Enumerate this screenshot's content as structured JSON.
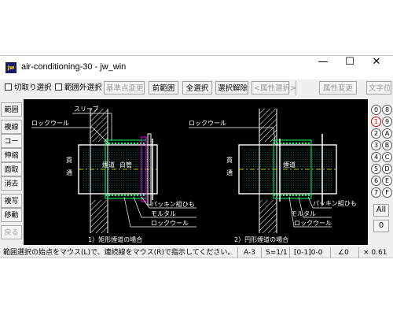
{
  "window": {
    "app_icon_text": "jw",
    "title": "air-conditioning-30 - jw_win",
    "min_glyph": "—",
    "max_glyph": "☐",
    "close_glyph": "✕"
  },
  "toolbar": {
    "crop_select": "切取り選択",
    "out_of_range_select": "範囲外選択",
    "base_point_change": "基準点変更",
    "prev_range": "前範囲",
    "select_all": "全選択",
    "deselect": "選択解除",
    "attr_select": "<属性選択>",
    "attr_change": "属性変更",
    "text_pos": "文字位"
  },
  "tools": [
    "範囲",
    "複線",
    "コーナー",
    "伸縮",
    "面取",
    "消去",
    "複写",
    "移動",
    "戻る"
  ],
  "layers": {
    "left": [
      "0",
      "1",
      "2",
      "3",
      "4",
      "5",
      "6",
      "7"
    ],
    "right": [
      "8",
      "9",
      "A",
      "B",
      "C",
      "D",
      "E",
      "F"
    ],
    "active": "1",
    "all": "All",
    "group": "0"
  },
  "drawing": {
    "left": {
      "sleeve": "スリーブ",
      "rockwool_top": "ロックウール",
      "side_wall": "貫",
      "side_wall2": "通",
      "duct": "煙道",
      "white_pipe": "白管",
      "packing": "パッキン組ひも",
      "mortar": "モルタル",
      "rockwool_bottom": "ロックウール",
      "caption": "1）矩形煙道の場合"
    },
    "right": {
      "rockwool_top": "ロックウール",
      "side_wall": "貫",
      "side_wall2": "通",
      "duct": "煙道",
      "packing": "パッキン組ひも",
      "mortar": "モルタル",
      "rockwool_bottom": "ロックウール",
      "caption": "2）円形煙道の場合"
    }
  },
  "status": {
    "message": "範囲選択の始点をマウス(L)で、連続線をマウス(R)で指示してください。",
    "paper": "A-3",
    "scale": "S=1/1",
    "layer": "[0-1]0-0",
    "angle": "∠0",
    "zoom": "× 0.61"
  },
  "colors": {
    "canvas": "#000000",
    "line_white": "#ffffff",
    "line_cyan": "#00ffff",
    "line_green": "#00ff66",
    "line_yellow": "#ffff00",
    "line_magenta": "#ff00ff",
    "line_blue": "#3355ff"
  }
}
